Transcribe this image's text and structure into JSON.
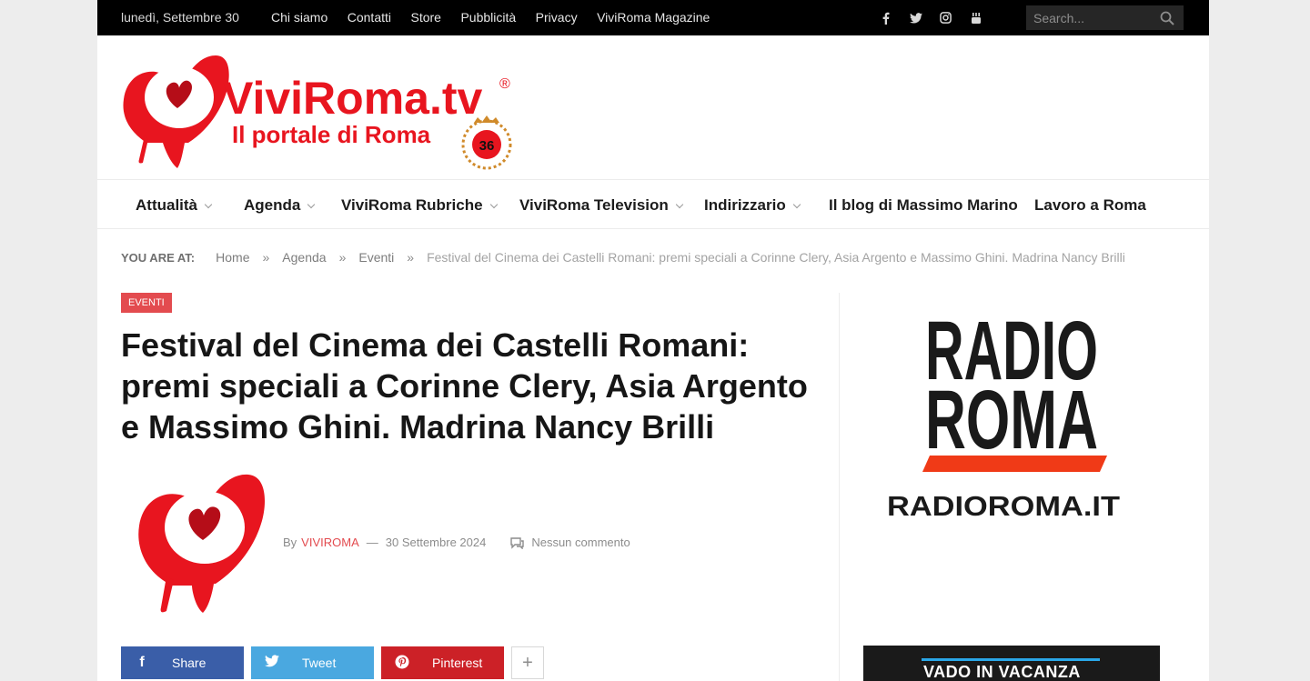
{
  "topbar": {
    "date": "lunedì, Settembre 30",
    "links": [
      "Chi siamo",
      "Contatti",
      "Store",
      "Pubblicità",
      "Privacy",
      "ViviRoma Magazine"
    ],
    "social": [
      "facebook-icon",
      "twitter-icon",
      "instagram-icon",
      "youtube-icon"
    ],
    "search_placeholder": "Search..."
  },
  "logo": {
    "title": "ViviRoma.tv",
    "registered": "®",
    "tagline": "Il portale di Roma",
    "badge": "36"
  },
  "nav": {
    "items": [
      {
        "label": "Attualità",
        "dropdown": true
      },
      {
        "label": "Agenda",
        "dropdown": true
      },
      {
        "label": "ViviRoma Rubriche",
        "dropdown": true
      },
      {
        "label": "ViviRoma Television",
        "dropdown": true
      },
      {
        "label": "Indirizzario",
        "dropdown": true
      },
      {
        "label": "Il blog di Massimo Marino",
        "dropdown": false
      },
      {
        "label": "Lavoro a Roma",
        "dropdown": false
      }
    ]
  },
  "breadcrumb": {
    "lead": "YOU ARE AT:",
    "items": [
      "Home",
      "Agenda",
      "Eventi"
    ],
    "separator": "»",
    "current": "Festival del Cinema dei Castelli Romani: premi speciali a Corinne Clery, Asia Argento e Massimo Ghini. Madrina Nancy Brilli"
  },
  "article": {
    "category": "EVENTI",
    "title": "Festival del Cinema dei Castelli Romani: premi speciali a Corinne Clery, Asia Argento e Massimo Ghini. Madrina Nancy Brilli",
    "by": "By",
    "author": "VIVIROMA",
    "dash": "—",
    "date": "30 Settembre 2024",
    "comments": "Nessun commento"
  },
  "share": {
    "facebook": "Share",
    "twitter": "Tweet",
    "pinterest": "Pinterest",
    "more": "+"
  },
  "sidebar": {
    "radio_line1": "RADIO",
    "radio_line2": "ROMA",
    "radio_url": "RADIOROMA.IT",
    "banner_text": "VADO IN VACANZA"
  },
  "colors": {
    "accent": "#e34b4f",
    "topbar_bg": "#000000",
    "facebook": "#3a5ea8",
    "twitter": "#4aa8e0",
    "pinterest": "#cc2127"
  }
}
